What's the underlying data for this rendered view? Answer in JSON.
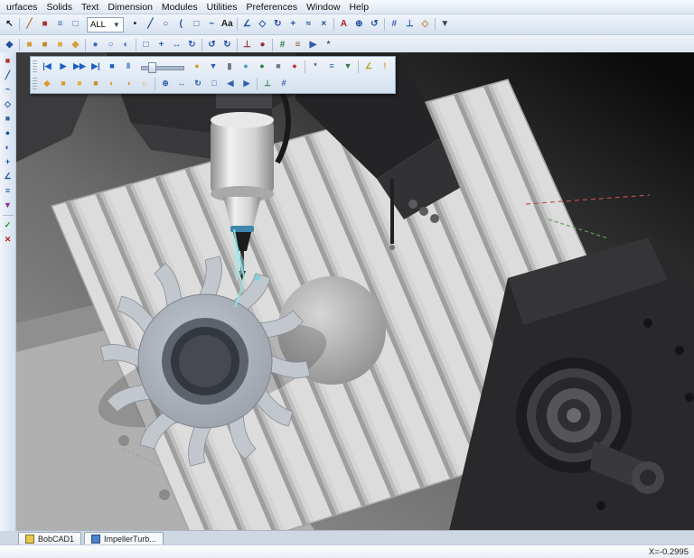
{
  "colors": {
    "toolbar_accent_blue": "#1c5fbf",
    "sim_orange": "#d79b2f",
    "ok_green": "#1f8f1f",
    "cancel_red": "#c02020",
    "toolpath_cyan": "#8fe4e4"
  },
  "menu": {
    "items": [
      "urfaces",
      "Solids",
      "Text",
      "Dimension",
      "Modules",
      "Utilities",
      "Preferences",
      "Window",
      "Help"
    ]
  },
  "toolbars": {
    "view_filter_value": "ALL",
    "row1_left": [
      {
        "n": "select-arrow-button",
        "g": "↖",
        "c": "#1a1a1a"
      },
      {
        "sep": true
      },
      {
        "n": "sketch-pencil-button",
        "g": "╱",
        "c": "#b87430"
      },
      {
        "n": "color-swatch-button",
        "g": "■",
        "c": "#b03030"
      },
      {
        "n": "line-style-button",
        "g": "≡",
        "c": "#3060b0"
      },
      {
        "n": "layers-button",
        "g": "□",
        "c": "#3060b0"
      }
    ],
    "row1_right": [
      {
        "n": "point-button",
        "g": "•",
        "c": "#202020"
      },
      {
        "n": "line-button",
        "g": "╱",
        "c": "#2050a0"
      },
      {
        "n": "circle-button",
        "g": "○",
        "c": "#2050a0"
      },
      {
        "n": "arc-button",
        "g": "(",
        "c": "#2050a0"
      },
      {
        "n": "rectangle-button",
        "g": "□",
        "c": "#2050a0"
      },
      {
        "n": "spline-button",
        "g": "~",
        "c": "#2050a0"
      },
      {
        "n": "text-button",
        "g": "Aa",
        "c": "#202020"
      },
      {
        "sep": true
      },
      {
        "n": "dimension-button",
        "g": "∠",
        "c": "#2050a0"
      },
      {
        "n": "mirror-button",
        "g": "◇",
        "c": "#2050a0"
      },
      {
        "n": "rotate-button",
        "g": "↻",
        "c": "#2050a0"
      },
      {
        "n": "translate-button",
        "g": "+",
        "c": "#2050a0"
      },
      {
        "n": "offset-button",
        "g": "≈",
        "c": "#2050a0"
      },
      {
        "n": "trim-button",
        "g": "×",
        "c": "#2050a0"
      },
      {
        "sep": true
      },
      {
        "n": "snap-magnet-button",
        "g": "A",
        "c": "#b02020"
      },
      {
        "n": "zoom-in-button",
        "g": "⊕",
        "c": "#2050a0"
      },
      {
        "n": "rotate-view-button",
        "g": "↺",
        "c": "#2050a0"
      },
      {
        "sep": true
      },
      {
        "n": "grid-button",
        "g": "#",
        "c": "#3060b0"
      },
      {
        "n": "axes-button",
        "g": "⊥",
        "c": "#3060b0"
      },
      {
        "n": "view-cube-button",
        "g": "◇",
        "c": "#c08030"
      },
      {
        "sep": true
      },
      {
        "n": "more-options-button",
        "g": "▼",
        "c": "#404040"
      }
    ],
    "row2": [
      {
        "n": "snap-settings-button",
        "g": "◆",
        "c": "#2050a0"
      },
      {
        "sep": true
      },
      {
        "n": "view-top-button",
        "g": "■",
        "c": "#d79b2f"
      },
      {
        "n": "view-front-button",
        "g": "■",
        "c": "#c8882a"
      },
      {
        "n": "view-side-button",
        "g": "■",
        "c": "#e0a93f"
      },
      {
        "n": "view-iso-button",
        "g": "◆",
        "c": "#d79b2f"
      },
      {
        "sep": true
      },
      {
        "n": "shaded-mode-button",
        "g": "●",
        "c": "#3b6fb5"
      },
      {
        "n": "wireframe-mode-button",
        "g": "○",
        "c": "#3b6fb5"
      },
      {
        "n": "hidden-line-button",
        "g": "◐",
        "c": "#3b6fb5"
      },
      {
        "sep": true
      },
      {
        "n": "zoom-fit-button",
        "g": "□",
        "c": "#2f5fae"
      },
      {
        "n": "zoom-window-button",
        "g": "+",
        "c": "#2f5fae"
      },
      {
        "n": "pan-button",
        "g": "↔",
        "c": "#2f5fae"
      },
      {
        "n": "rotate-3d-button",
        "g": "↻",
        "c": "#2f5fae"
      },
      {
        "sep": true
      },
      {
        "n": "undo-button",
        "g": "↺",
        "c": "#2050a0"
      },
      {
        "n": "redo-button",
        "g": "↻",
        "c": "#2050a0"
      },
      {
        "sep": true
      },
      {
        "n": "ucs-button",
        "g": "⊥",
        "c": "#9a2f2f"
      },
      {
        "n": "origin-button",
        "g": "●",
        "c": "#9a2f2f"
      },
      {
        "sep": true
      },
      {
        "n": "stock-wizard-button",
        "g": "#",
        "c": "#2f7f3f"
      },
      {
        "n": "machine-setup-button",
        "g": "≡",
        "c": "#7f5f2f"
      },
      {
        "n": "post-process-button",
        "g": "▶",
        "c": "#2f5fae"
      },
      {
        "n": "settings-gear-button",
        "g": "*",
        "c": "#555555"
      }
    ],
    "left_column": [
      {
        "n": "workspace-button",
        "g": "■",
        "c": "#b03030"
      },
      {
        "n": "sketch-mode-button",
        "g": "╱",
        "c": "#2050a0"
      },
      {
        "n": "curves-button",
        "g": "~",
        "c": "#2050a0"
      },
      {
        "n": "surfaces-button",
        "g": "◇",
        "c": "#2050a0"
      },
      {
        "n": "solids-button",
        "g": "■",
        "c": "#4060a0"
      },
      {
        "n": "primitives-button",
        "g": "●",
        "c": "#2050a0"
      },
      {
        "n": "boolean-button",
        "g": "◐",
        "c": "#2050a0"
      },
      {
        "n": "transform-button",
        "g": "+",
        "c": "#2050a0"
      },
      {
        "n": "measure-button",
        "g": "∠",
        "c": "#2050a0"
      },
      {
        "n": "layers-panel-button",
        "g": "≡",
        "c": "#2050a0"
      },
      {
        "n": "toolpath-button",
        "g": "▼",
        "c": "#8030a0"
      },
      {
        "sep": true
      },
      {
        "n": "ok-accept-button",
        "g": "✓",
        "c": "#1f8f1f"
      },
      {
        "n": "cancel-button",
        "g": "✕",
        "c": "#c02020"
      }
    ],
    "sim_playback": [
      {
        "n": "go-to-start-button",
        "g": "|◀",
        "c": "#1c5fbf"
      },
      {
        "n": "play-button",
        "g": "▶",
        "c": "#1c5fbf"
      },
      {
        "n": "fast-forward-button",
        "g": "▶▶",
        "c": "#1c5fbf"
      },
      {
        "n": "step-forward-button",
        "g": "▶|",
        "c": "#1c5fbf"
      },
      {
        "n": "stop-button",
        "g": "■",
        "c": "#1c5fbf"
      },
      {
        "n": "pause-button",
        "g": "‖",
        "c": "#1c5fbf"
      }
    ],
    "sim_tools": [
      {
        "n": "turbo-mode-button",
        "g": "●",
        "c": "#d79b2f"
      },
      {
        "n": "show-tool-button",
        "g": "▼",
        "c": "#2f5fae"
      },
      {
        "n": "show-holder-button",
        "g": "▮",
        "c": "#6b7685"
      },
      {
        "n": "stock-display-button",
        "g": "●",
        "c": "#3fa0c0"
      },
      {
        "n": "target-display-button",
        "g": "●",
        "c": "#2f7f3f"
      },
      {
        "n": "machine-housing-button",
        "g": "■",
        "c": "#70798a"
      },
      {
        "n": "collision-check-button",
        "g": "●",
        "c": "#c03030"
      },
      {
        "sep": true
      },
      {
        "n": "sim-settings-gear-button",
        "g": "*",
        "c": "#555555"
      },
      {
        "n": "report-button",
        "g": "≡",
        "c": "#2f5fae"
      },
      {
        "n": "save-stock-button",
        "g": "▼",
        "c": "#2f7f3f"
      },
      {
        "sep": true
      },
      {
        "n": "measure-sim-button",
        "g": "∠",
        "c": "#b0a020"
      },
      {
        "n": "analyze-flash-button",
        "g": "!",
        "c": "#d7a02f"
      }
    ],
    "sim_row2": [
      {
        "n": "iso-view-cube-button",
        "g": "◆",
        "c": "#d79b2f"
      },
      {
        "n": "front-view-cube-button",
        "g": "■",
        "c": "#d79b2f"
      },
      {
        "n": "top-view-cube-button",
        "g": "■",
        "c": "#e0ae4a"
      },
      {
        "n": "side-view-cube-button",
        "g": "■",
        "c": "#c9912c"
      },
      {
        "n": "section-x-button",
        "g": "◐",
        "c": "#d79b2f"
      },
      {
        "n": "section-y-button",
        "g": "◑",
        "c": "#d79b2f"
      },
      {
        "n": "section-off-button",
        "g": "○",
        "c": "#d79b2f"
      },
      {
        "sep": true
      },
      {
        "n": "sim-zoom-button",
        "g": "⊕",
        "c": "#2f5fae"
      },
      {
        "n": "sim-pan-button",
        "g": "↔",
        "c": "#2f5fae"
      },
      {
        "n": "sim-rotate-button",
        "g": "↻",
        "c": "#2f5fae"
      },
      {
        "n": "sim-fit-button",
        "g": "□",
        "c": "#2f5fae"
      },
      {
        "n": "prev-operation-button",
        "g": "◀",
        "c": "#2f5fae"
      },
      {
        "n": "next-operation-button",
        "g": "▶",
        "c": "#2f5fae"
      },
      {
        "sep": true
      },
      {
        "n": "sim-axes-button",
        "g": "⊥",
        "c": "#2f7f3f"
      },
      {
        "n": "sim-coords-button",
        "g": "#",
        "c": "#2f5fae"
      }
    ]
  },
  "tabs": {
    "items": [
      {
        "label": "BobCAD1"
      },
      {
        "label": "ImpellerTurb..."
      }
    ]
  },
  "statusbar": {
    "x_readout": "X=-0.2995"
  }
}
